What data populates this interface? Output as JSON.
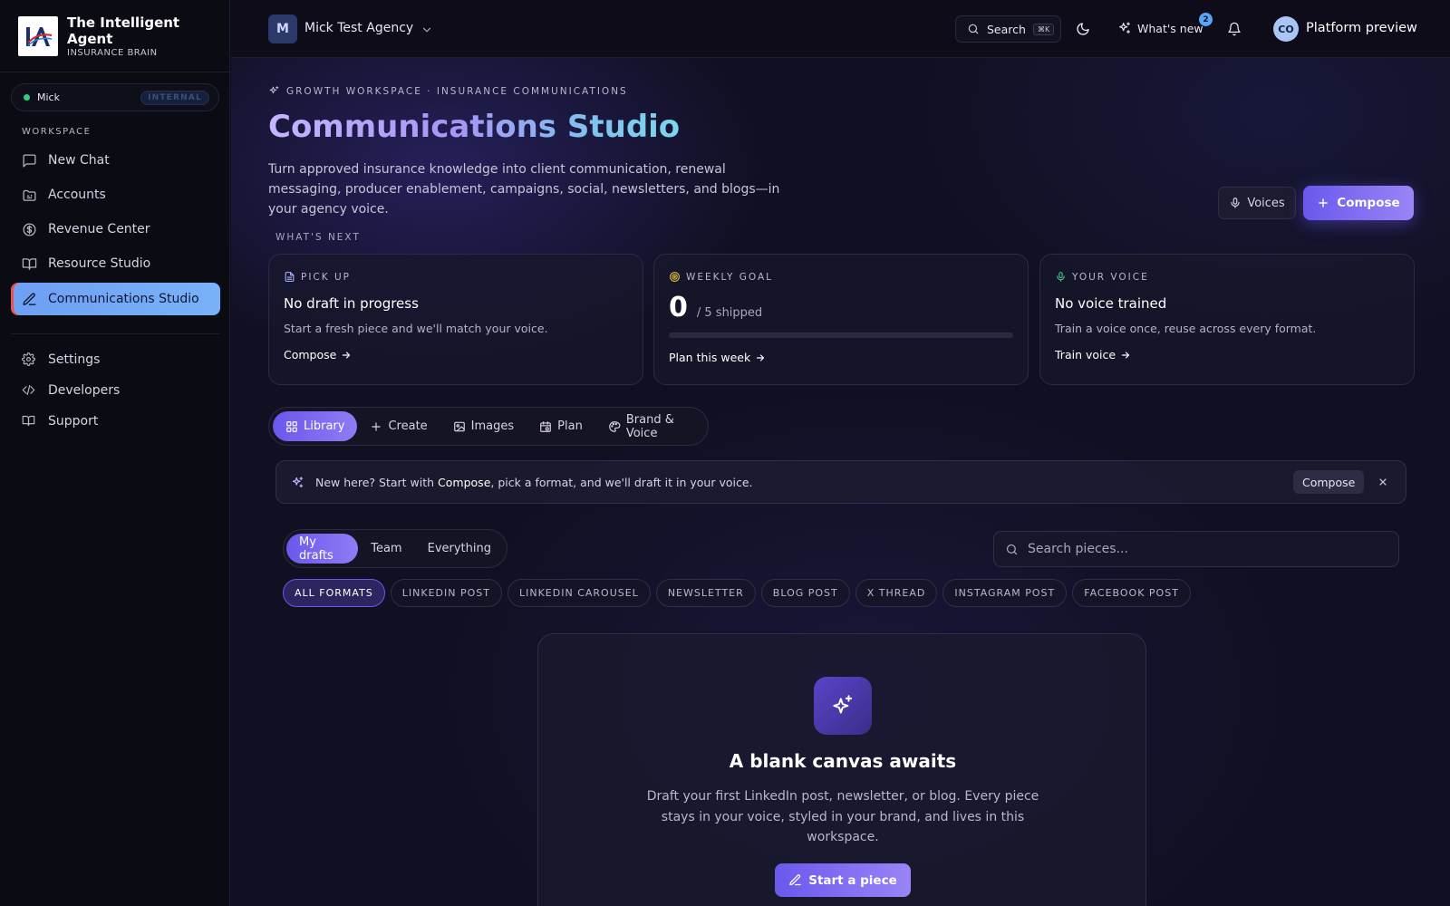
{
  "brand": {
    "title": "The Intelligent Agent",
    "subtitle": "INSURANCE BRAIN"
  },
  "user": {
    "name": "Mick",
    "badge": "INTERNAL"
  },
  "sidebar": {
    "section_label": "WORKSPACE",
    "items": [
      {
        "label": "New Chat",
        "icon": "chat-icon"
      },
      {
        "label": "Accounts",
        "icon": "folder-icon"
      },
      {
        "label": "Revenue Center",
        "icon": "dollar-icon"
      },
      {
        "label": "Resource Studio",
        "icon": "book-icon"
      },
      {
        "label": "Communications Studio",
        "icon": "pen-icon",
        "active": true
      }
    ],
    "footer_items": [
      {
        "label": "Settings",
        "icon": "gear-icon"
      },
      {
        "label": "Developers",
        "icon": "code-icon"
      },
      {
        "label": "Support",
        "icon": "book-icon"
      }
    ]
  },
  "topbar": {
    "agency_initial": "M",
    "agency_name": "Mick Test Agency",
    "search_label": "Search",
    "search_shortcut": "⌘K",
    "whats_new_label": "What's new",
    "whats_new_count": "2",
    "profile_initials": "CO",
    "profile_label": "Platform preview"
  },
  "header": {
    "eyebrow": "GROWTH WORKSPACE · INSURANCE COMMUNICATIONS",
    "title": "Communications Studio",
    "description": "Turn approved insurance knowledge into client communication, renewal messaging, producer enablement, campaigns, social, newsletters, and blogs—in your agency voice.",
    "voices_label": "Voices",
    "compose_label": "Compose"
  },
  "whats_next": {
    "label": "WHAT'S NEXT",
    "cards": {
      "pickup": {
        "eyebrow": "PICK UP",
        "title": "No draft in progress",
        "text": "Start a fresh piece and we'll match your voice.",
        "link": "Compose"
      },
      "goal": {
        "eyebrow": "WEEKLY GOAL",
        "value": "0",
        "of_text": "/ 5 shipped",
        "progress": 0,
        "link": "Plan this week"
      },
      "voice": {
        "eyebrow": "YOUR VOICE",
        "title": "No voice trained",
        "text": "Train a voice once, reuse across every format.",
        "link": "Train voice"
      }
    }
  },
  "tabs": [
    {
      "label": "Library",
      "icon": "grid-icon",
      "active": true
    },
    {
      "label": "Create",
      "icon": "plus-icon"
    },
    {
      "label": "Images",
      "icon": "image-icon"
    },
    {
      "label": "Plan",
      "icon": "calendar-icon"
    },
    {
      "label": "Brand & Voice",
      "icon": "palette-icon"
    }
  ],
  "banner": {
    "prefix": "New here? Start with",
    "strong": "Compose",
    "suffix": ", pick a format, and we'll draft it in your voice.",
    "button": "Compose"
  },
  "filters": {
    "scopes": [
      {
        "label": "My drafts",
        "active": true
      },
      {
        "label": "Team"
      },
      {
        "label": "Everything"
      }
    ],
    "search_placeholder": "Search pieces...",
    "formats": [
      {
        "label": "ALL FORMATS",
        "active": true
      },
      {
        "label": "LINKEDIN POST"
      },
      {
        "label": "LINKEDIN CAROUSEL"
      },
      {
        "label": "NEWSLETTER"
      },
      {
        "label": "BLOG POST"
      },
      {
        "label": "X THREAD"
      },
      {
        "label": "INSTAGRAM POST"
      },
      {
        "label": "FACEBOOK POST"
      }
    ]
  },
  "empty_state": {
    "title": "A blank canvas awaits",
    "text": "Draft your first LinkedIn post, newsletter, or blog. Every piece stays in your voice, styled in your brand, and lives in this workspace.",
    "button": "Start a piece"
  },
  "colors": {
    "accent": "#6a58ec",
    "accent_light": "#9a84f7",
    "active_nav": "#6e9ff3",
    "status_online": "#2fd07a"
  }
}
